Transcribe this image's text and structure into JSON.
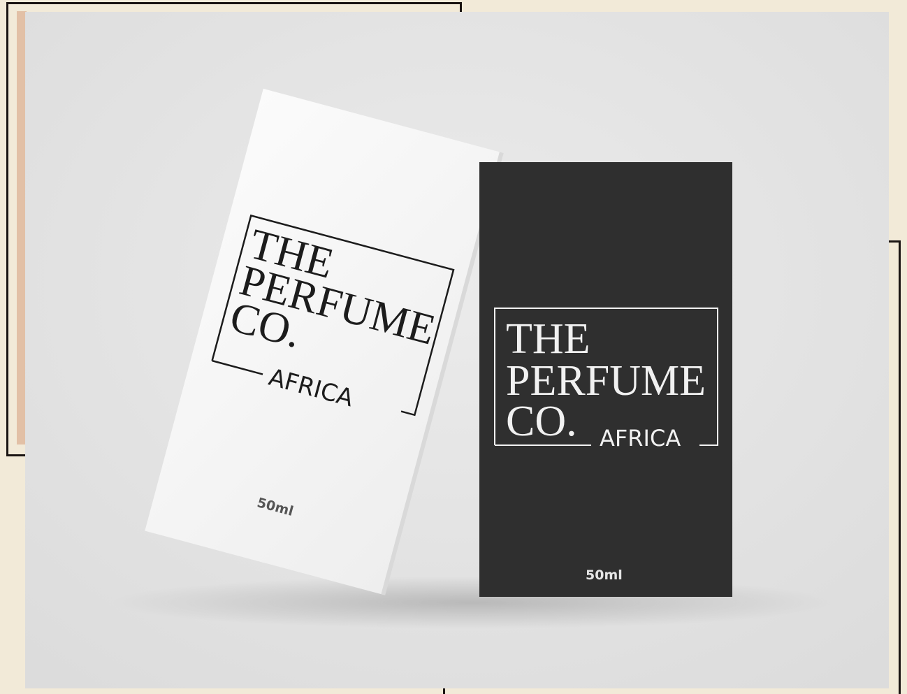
{
  "colors": {
    "page_background": "#f2ead8",
    "frame_line": "#1a1412",
    "frame_accent": "#e2c0a6",
    "photo_background": "#e3e3e3",
    "white_box": "#f7f7f7",
    "black_box": "#2f2f2f",
    "ink_dark": "#1c1c1c",
    "ink_light": "#f1f1f1"
  },
  "white_box": {
    "brand_line_1": "THE",
    "brand_line_2": "PERFUME",
    "brand_line_3": "CO.",
    "region": "AFRICA",
    "volume": "50ml"
  },
  "black_box": {
    "brand_line_1": "THE",
    "brand_line_2": "PERFUME",
    "brand_line_3": "CO.",
    "region": "AFRICA",
    "volume": "50ml"
  }
}
